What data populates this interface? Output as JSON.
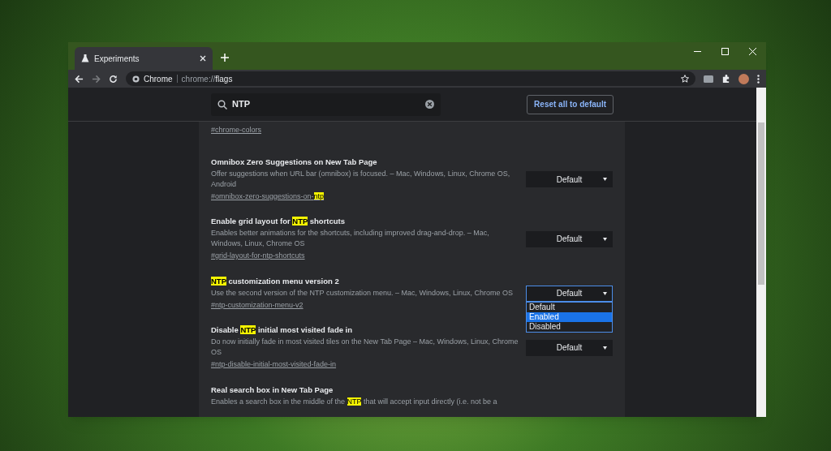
{
  "window": {
    "tab": {
      "title": "Experiments"
    },
    "address": {
      "host": "Chrome",
      "url_scheme": "chrome://",
      "url_path": "flags"
    },
    "forward": {
      "disabled": true
    }
  },
  "search": {
    "value": "NTP"
  },
  "reset_button": "Reset all to default",
  "flags": [
    {
      "link": [
        {
          "text": "#chrome-colors",
          "highlight": false
        }
      ]
    },
    {
      "title": [
        {
          "text": "Omnibox Zero Suggestions on New Tab Page",
          "highlight": false
        }
      ],
      "description": [
        {
          "text": "Offer suggestions when URL bar (omnibox) is focused. – Mac, Windows, Linux, Chrome OS, Android",
          "highlight": false
        }
      ],
      "link": [
        {
          "text": "#omnibox-zero-suggestions-on-",
          "highlight": false
        },
        {
          "text": "ntp",
          "highlight": true
        }
      ],
      "select": {
        "value": "Default",
        "open": false
      }
    },
    {
      "title": [
        {
          "text": "Enable grid layout for ",
          "highlight": false
        },
        {
          "text": "NTP",
          "highlight": true
        },
        {
          "text": " shortcuts",
          "highlight": false
        }
      ],
      "description": [
        {
          "text": "Enables better animations for the shortcuts, including improved drag-and-drop. – Mac, Windows, Linux, Chrome OS",
          "highlight": false
        }
      ],
      "link": [
        {
          "text": "#grid-layout-for-ntp-shortcuts",
          "highlight": false
        }
      ],
      "select": {
        "value": "Default",
        "open": false
      }
    },
    {
      "title": [
        {
          "text": "NTP",
          "highlight": true
        },
        {
          "text": " customization menu version 2",
          "highlight": false
        }
      ],
      "description": [
        {
          "text": "Use the second version of the NTP customization menu. – Mac, Windows, Linux, Chrome OS",
          "highlight": false
        }
      ],
      "link": [
        {
          "text": "#ntp-customization-menu-v2",
          "highlight": false
        }
      ],
      "select": {
        "value": "Default",
        "open": true,
        "options": [
          {
            "label": "Default",
            "highlighted": false
          },
          {
            "label": "Enabled",
            "highlighted": true
          },
          {
            "label": "Disabled",
            "highlighted": false
          }
        ]
      }
    },
    {
      "title": [
        {
          "text": "Disable ",
          "highlight": false
        },
        {
          "text": "NTP",
          "highlight": true
        },
        {
          "text": " initial most visited fade in",
          "highlight": false
        }
      ],
      "description": [
        {
          "text": "Do now initially fade in most visited tiles on the New Tab Page – Mac, Windows, Linux, Chrome OS",
          "highlight": false
        }
      ],
      "link": [
        {
          "text": "#ntp-disable-initial-most-visited-fade-in",
          "highlight": false
        }
      ],
      "select": {
        "value": "Default",
        "open": false
      }
    },
    {
      "title": [
        {
          "text": "Real search box in New Tab Page",
          "highlight": false
        }
      ],
      "description": [
        {
          "text": "Enables a search box in the middle of the ",
          "highlight": false
        },
        {
          "text": "NTP",
          "highlight": true
        },
        {
          "text": " that will accept input directly (i.e. not be a",
          "highlight": false
        }
      ]
    }
  ]
}
